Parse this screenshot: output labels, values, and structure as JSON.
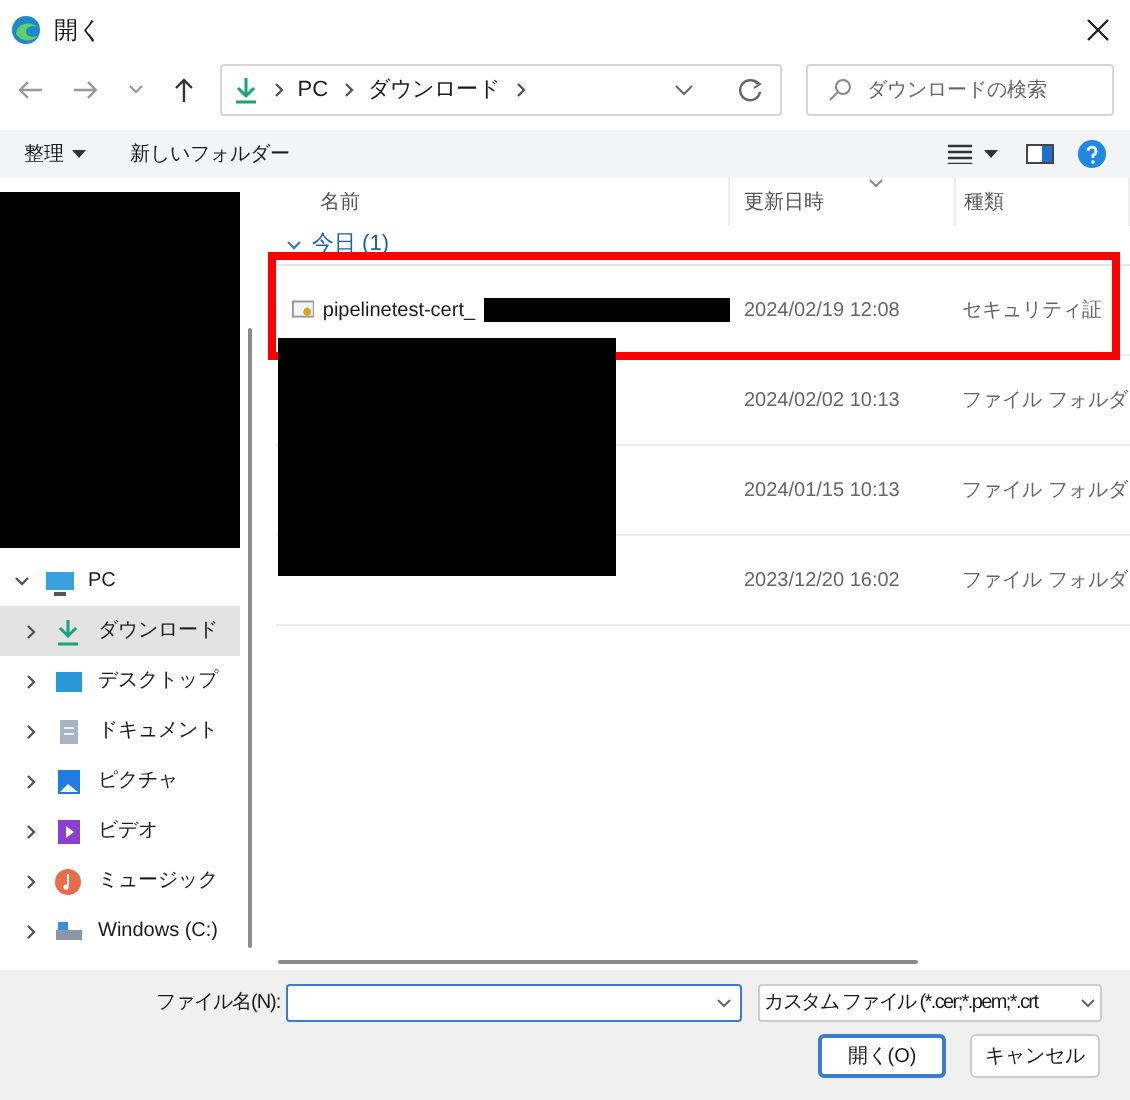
{
  "window": {
    "title": "開く"
  },
  "address": {
    "path": [
      "PC",
      "ダウンロード"
    ]
  },
  "search": {
    "placeholder": "ダウンロードの検索"
  },
  "toolbar": {
    "organize": "整理",
    "new_folder": "新しいフォルダー"
  },
  "nav_tree": [
    {
      "label": "PC",
      "kind": "pc",
      "expanded": true,
      "selected": false,
      "children": [
        {
          "label": "ダウンロード",
          "kind": "download",
          "selected": true
        },
        {
          "label": "デスクトップ",
          "kind": "desktop",
          "selected": false
        },
        {
          "label": "ドキュメント",
          "kind": "documents",
          "selected": false
        },
        {
          "label": "ピクチャ",
          "kind": "pictures",
          "selected": false
        },
        {
          "label": "ビデオ",
          "kind": "videos",
          "selected": false
        },
        {
          "label": "ミュージック",
          "kind": "music",
          "selected": false
        },
        {
          "label": "Windows (C:)",
          "kind": "drive",
          "selected": false
        }
      ]
    }
  ],
  "columns": [
    "名前",
    "更新日時",
    "種類"
  ],
  "group": {
    "label": "今日 (1)",
    "expanded": true
  },
  "files": [
    {
      "name": "pipelinetest-cert_",
      "modified": "2024/02/19 12:08",
      "type": "セキュリティ証",
      "highlighted": true
    },
    {
      "modified": "2024/02/02 10:13",
      "type": "ファイル フォルダ",
      "highlighted": false
    },
    {
      "modified": "2024/01/15 10:13",
      "type": "ファイル フォルダ",
      "highlighted": false
    },
    {
      "modified": "2023/12/20 16:02",
      "type": "ファイル フォルダ",
      "highlighted": false
    }
  ],
  "footer": {
    "file_name_label": "ファイル名(N):",
    "filter": "カスタム ファイル (*.cer;*.pem;*.crt",
    "open": "開く(O)",
    "cancel": "キャンセル"
  }
}
